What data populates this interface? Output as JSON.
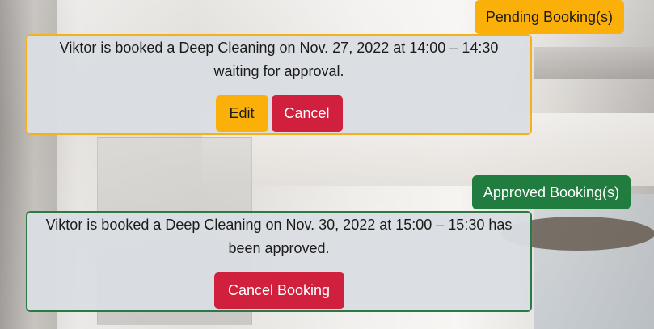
{
  "pending": {
    "heading": "Pending Booking(s)",
    "bookings": [
      {
        "text": "Viktor is booked a Deep Cleaning on Nov. 27, 2022 at 14:00 – 14:30 waiting for approval.",
        "edit_label": "Edit",
        "cancel_label": "Cancel"
      }
    ]
  },
  "approved": {
    "heading": "Approved Booking(s)",
    "bookings": [
      {
        "text": "Viktor is booked a Deep Cleaning on Nov. 30, 2022 at 15:00 – 15:30 has been approved.",
        "cancel_label": "Cancel Booking"
      }
    ]
  },
  "colors": {
    "pending_accent": "#fbb009",
    "approved_accent": "#217d3f",
    "danger": "#d11f3e",
    "card_bg": "#dadee3"
  }
}
